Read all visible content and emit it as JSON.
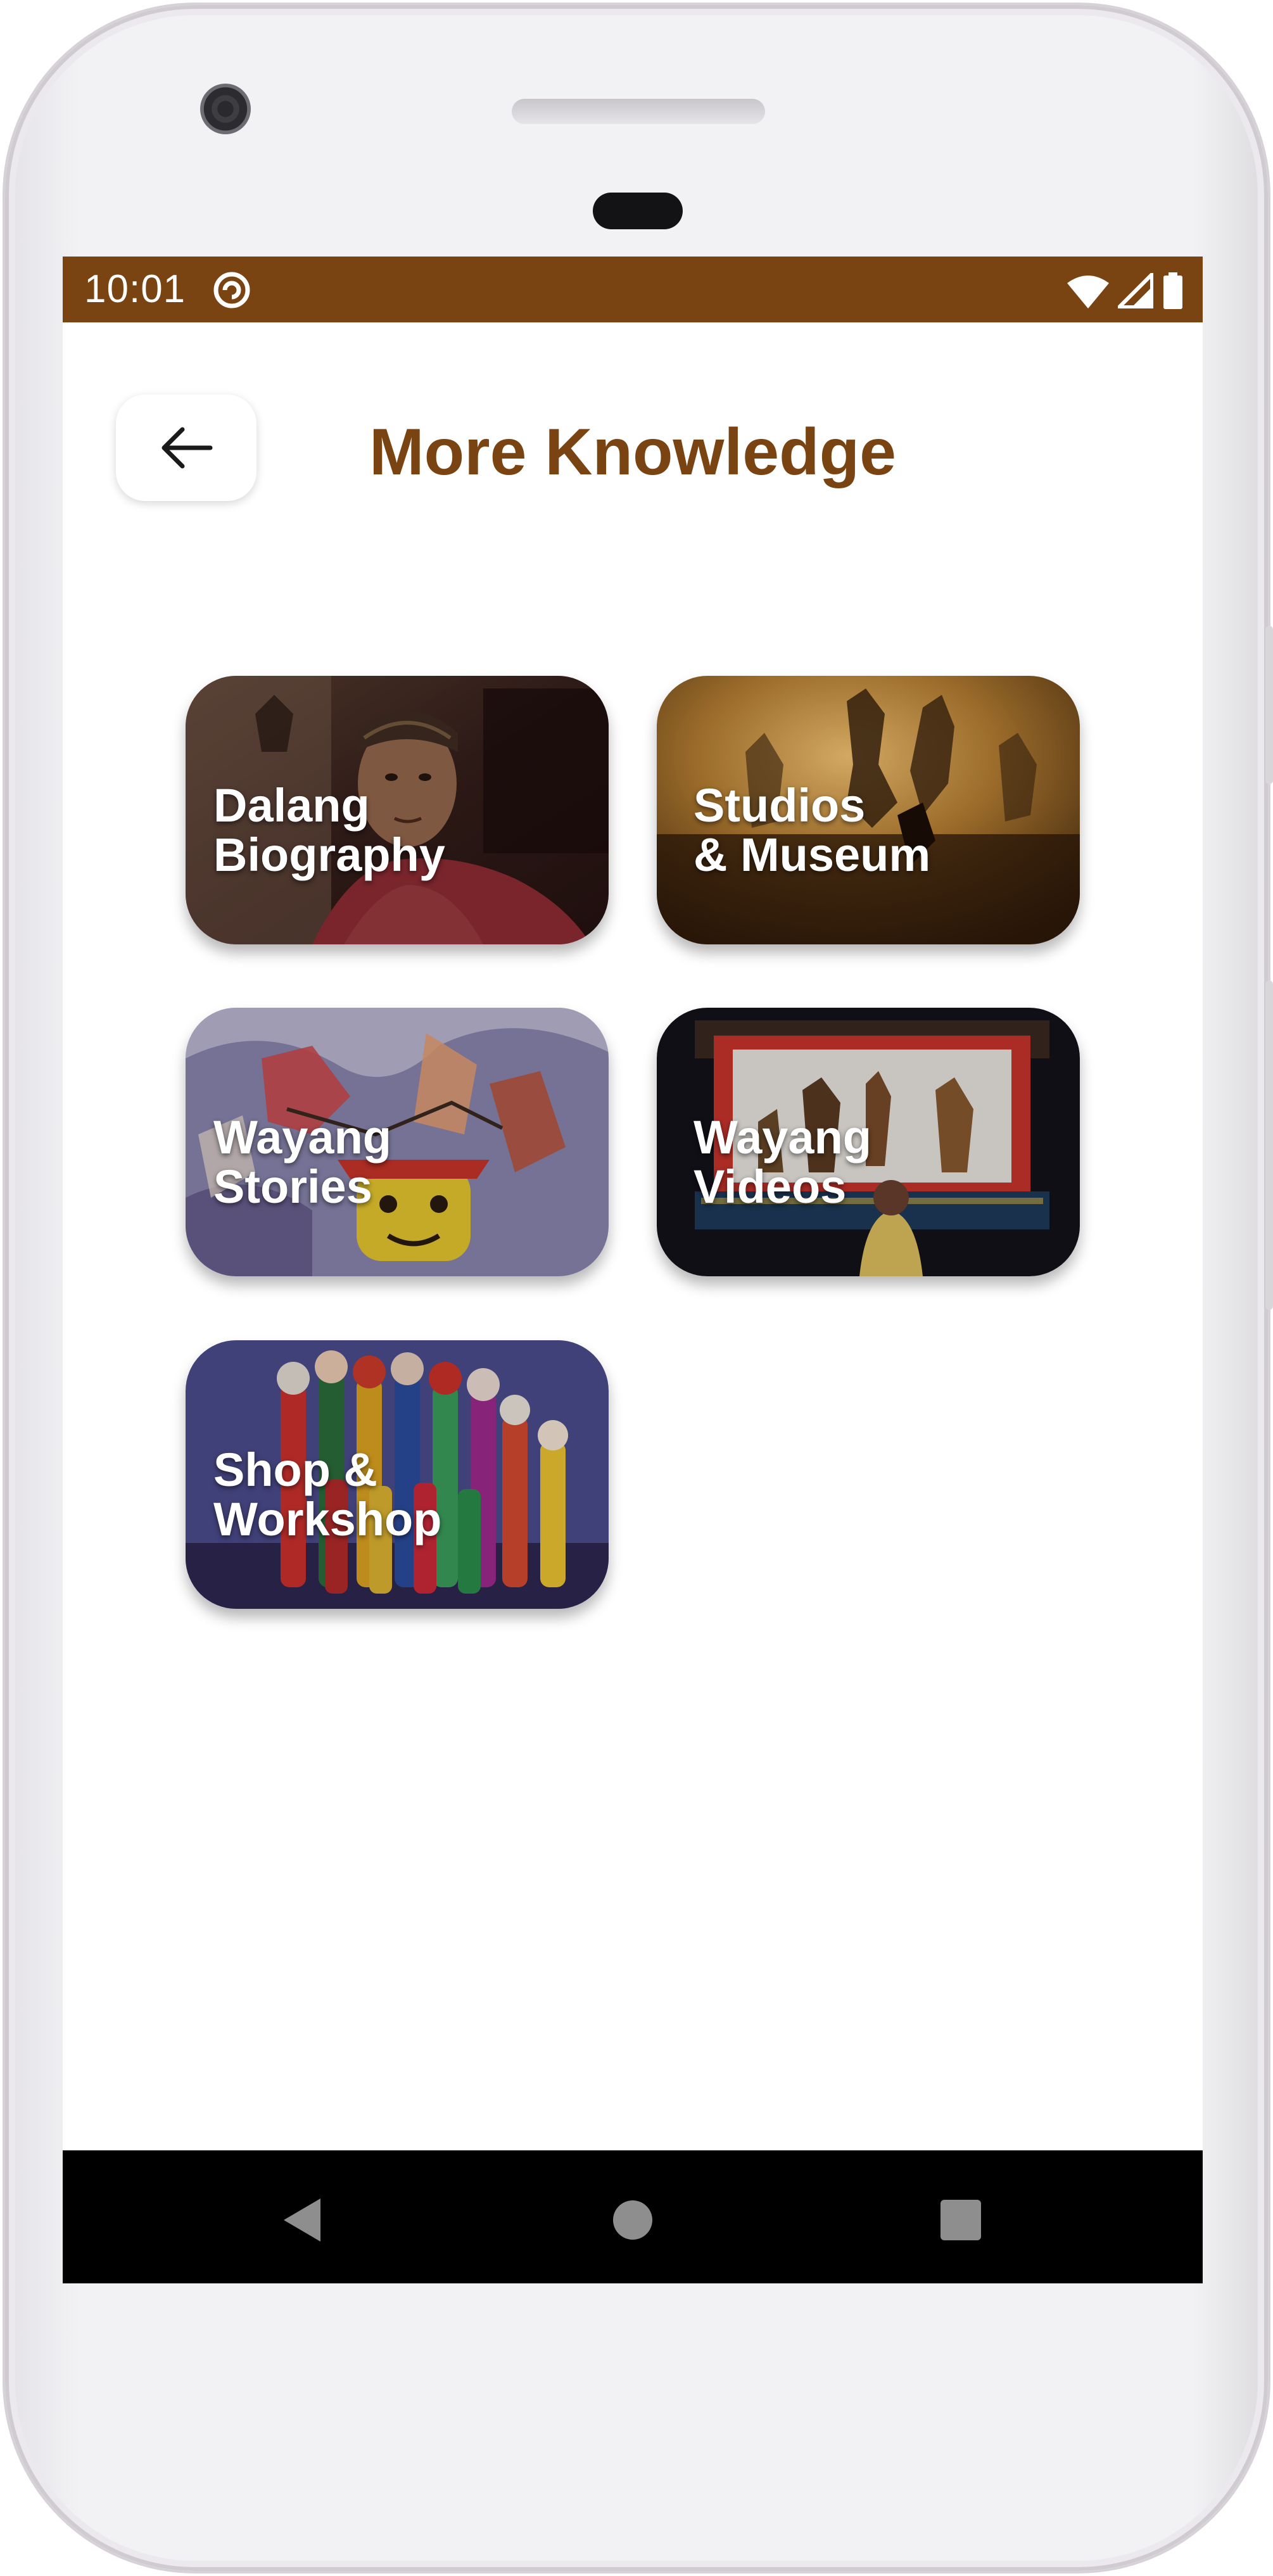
{
  "status_bar": {
    "time": "10:01",
    "icons": [
      "do-not-disturb-icon",
      "wifi-icon",
      "cell-signal-icon",
      "battery-icon"
    ],
    "background_color": "#7a4412"
  },
  "header": {
    "back_icon": "arrow-left-icon",
    "title": "More Knowledge",
    "title_color": "#7a4412"
  },
  "cards": [
    {
      "line1": "Dalang",
      "line2": "Biography"
    },
    {
      "line1": "Studios",
      "line2": "& Museum"
    },
    {
      "line1": "Wayang",
      "line2": "Stories"
    },
    {
      "line1": "Wayang",
      "line2": "Videos"
    },
    {
      "line1": "Shop &",
      "line2": "Workshop"
    }
  ],
  "nav_bar": {
    "icons": [
      "back-triangle-icon",
      "home-circle-icon",
      "recents-square-icon"
    ]
  }
}
